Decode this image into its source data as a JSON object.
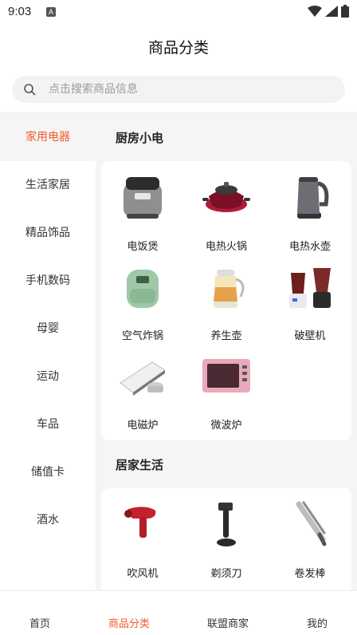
{
  "status": {
    "time": "9:03",
    "notification_icon": "a-icon"
  },
  "header": {
    "title": "商品分类"
  },
  "search": {
    "placeholder": "点击搜索商品信息",
    "value": ""
  },
  "sidebar": {
    "items": [
      {
        "label": "家用电器",
        "active": true
      },
      {
        "label": "生活家居"
      },
      {
        "label": "精品饰品"
      },
      {
        "label": "手机数码"
      },
      {
        "label": "母婴"
      },
      {
        "label": "运动"
      },
      {
        "label": "车品"
      },
      {
        "label": "储值卡"
      },
      {
        "label": "酒水"
      }
    ]
  },
  "sections": [
    {
      "title": "厨房小电",
      "products": [
        {
          "label": "电饭煲",
          "icon": "rice-cooker-icon"
        },
        {
          "label": "电热火锅",
          "icon": "hot-pot-icon"
        },
        {
          "label": "电热水壶",
          "icon": "kettle-icon"
        },
        {
          "label": "空气炸锅",
          "icon": "air-fryer-icon"
        },
        {
          "label": "养生壶",
          "icon": "health-pot-icon"
        },
        {
          "label": "破壁机",
          "icon": "blender-icon"
        },
        {
          "label": "电磁炉",
          "icon": "induction-cooker-icon"
        },
        {
          "label": "微波炉",
          "icon": "microwave-icon"
        }
      ]
    },
    {
      "title": "居家生活",
      "products": [
        {
          "label": "吹风机",
          "icon": "hair-dryer-icon"
        },
        {
          "label": "剃须刀",
          "icon": "razor-icon"
        },
        {
          "label": "卷发棒",
          "icon": "curling-iron-icon"
        }
      ]
    }
  ],
  "bottom_nav": {
    "items": [
      {
        "label": "首页"
      },
      {
        "label": "商品分类",
        "active": true
      },
      {
        "label": "联盟商家"
      },
      {
        "label": "我的"
      }
    ]
  },
  "colors": {
    "accent": "#f15b2a",
    "background": "#f5f5f5",
    "card": "#ffffff"
  }
}
